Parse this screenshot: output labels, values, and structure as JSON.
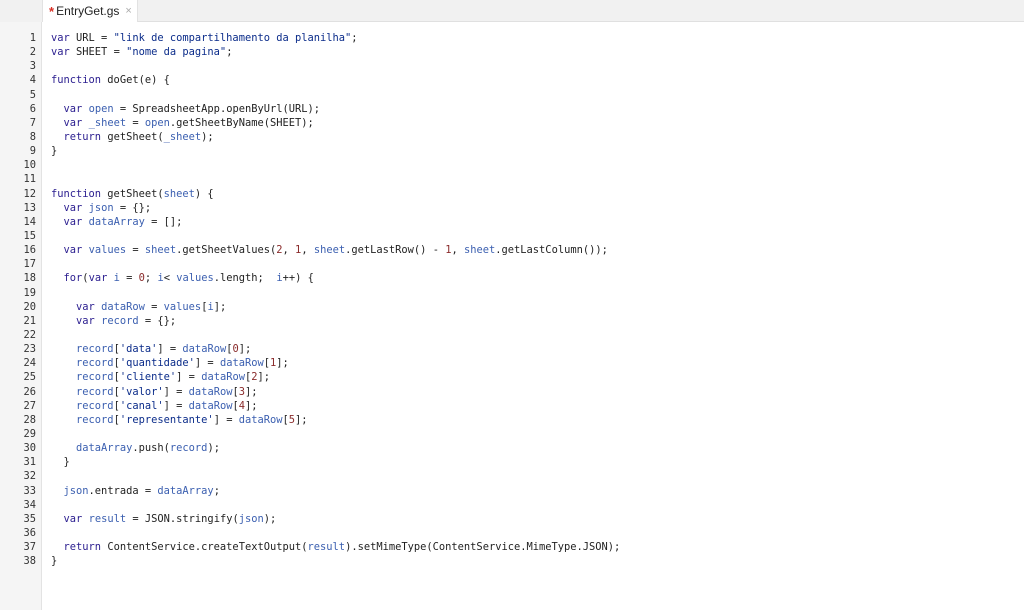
{
  "tab": {
    "modified_marker": "*",
    "filename": "EntryGet.gs",
    "close_glyph": "×"
  },
  "code_lines": [
    "var URL = \"link de compartilhamento da planilha\";",
    "var SHEET = \"nome da pagina\";",
    "",
    "function doGet(e) {",
    "",
    "  var open = SpreadsheetApp.openByUrl(URL);",
    "  var _sheet = open.getSheetByName(SHEET);",
    "  return getSheet(_sheet);",
    "}",
    "",
    "",
    "function getSheet(sheet) {",
    "  var json = {};",
    "  var dataArray = [];",
    "",
    "  var values = sheet.getSheetValues(2, 1, sheet.getLastRow() - 1, sheet.getLastColumn());",
    "",
    "  for(var i = 0; i< values.length;  i++) {",
    "",
    "    var dataRow = values[i];",
    "    var record = {};",
    "",
    "    record['data'] = dataRow[0];",
    "    record['quantidade'] = dataRow[1];",
    "    record['cliente'] = dataRow[2];",
    "    record['valor'] = dataRow[3];",
    "    record['canal'] = dataRow[4];",
    "    record['representante'] = dataRow[5];",
    "",
    "    dataArray.push(record);",
    "  }",
    "",
    "  json.entrada = dataArray;",
    "",
    "  var result = JSON.stringify(json);",
    "",
    "  return ContentService.createTextOutput(result).setMimeType(ContentService.MimeType.JSON);",
    "}"
  ],
  "colors": {
    "keyword": "#2a1d8f",
    "string": "#0b2c8a",
    "number": "#8a2b2b",
    "identifier": "#3b5fb0",
    "modified": "#d93025"
  }
}
